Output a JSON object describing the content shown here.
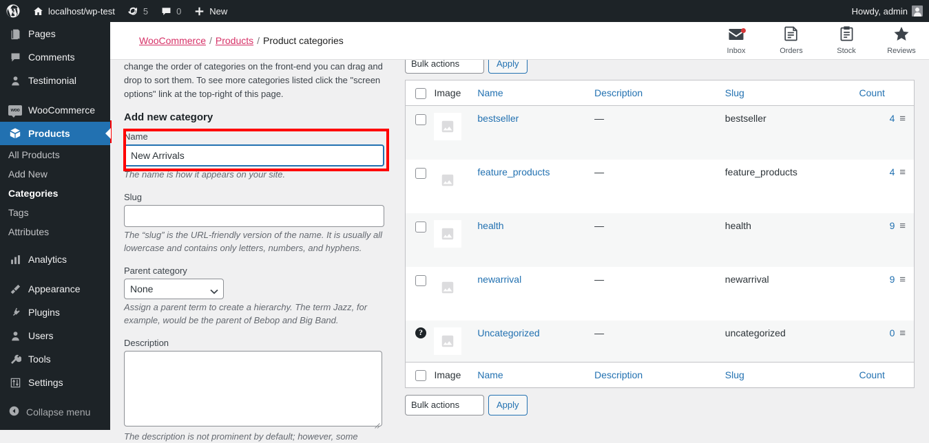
{
  "adminbar": {
    "site_name": "localhost/wp-test",
    "updates_count": "5",
    "comments_count": "0",
    "new_label": "New",
    "howdy": "Howdy, admin"
  },
  "sidebar": {
    "items": [
      {
        "label": "Pages",
        "icon": "pages-icon",
        "type": "top"
      },
      {
        "label": "Comments",
        "icon": "comments-icon",
        "type": "top"
      },
      {
        "label": "Testimonial",
        "icon": "testimonial-icon",
        "type": "top"
      },
      {
        "label": "WooCommerce",
        "icon": "woocommerce-icon",
        "type": "top"
      },
      {
        "label": "Products",
        "icon": "products-icon",
        "type": "top",
        "current": true
      },
      {
        "label": "All Products",
        "type": "sub"
      },
      {
        "label": "Add New",
        "type": "sub"
      },
      {
        "label": "Categories",
        "type": "sub",
        "current": true
      },
      {
        "label": "Tags",
        "type": "sub"
      },
      {
        "label": "Attributes",
        "type": "sub"
      },
      {
        "label": "Analytics",
        "icon": "analytics-icon",
        "type": "top"
      },
      {
        "label": "Appearance",
        "icon": "appearance-icon",
        "type": "top"
      },
      {
        "label": "Plugins",
        "icon": "plugins-icon",
        "type": "top"
      },
      {
        "label": "Users",
        "icon": "users-icon",
        "type": "top"
      },
      {
        "label": "Tools",
        "icon": "tools-icon",
        "type": "top"
      },
      {
        "label": "Settings",
        "icon": "settings-icon",
        "type": "top"
      }
    ],
    "collapse_label": "Collapse menu"
  },
  "header": {
    "breadcrumb": {
      "root": "WooCommerce",
      "parent": "Products",
      "current": "Product categories",
      "separator": "/"
    },
    "actions": [
      {
        "label": "Inbox",
        "icon": "inbox-icon",
        "badge": true
      },
      {
        "label": "Orders",
        "icon": "orders-icon",
        "badge": false
      },
      {
        "label": "Stock",
        "icon": "stock-icon",
        "badge": false
      },
      {
        "label": "Reviews",
        "icon": "reviews-icon",
        "badge": false
      }
    ]
  },
  "form": {
    "intro_text": "change the order of categories on the front-end you can drag and drop to sort them. To see more categories listed click the \"screen options\" link at the top-right of this page.",
    "heading": "Add new category",
    "name": {
      "label": "Name",
      "value": "New Arrivals",
      "help": "The name is how it appears on your site."
    },
    "slug": {
      "label": "Slug",
      "value": "",
      "help": "The “slug” is the URL-friendly version of the name. It is usually all lowercase and contains only letters, numbers, and hyphens."
    },
    "parent": {
      "label": "Parent category",
      "value": "None",
      "options": [
        "None"
      ],
      "help": "Assign a parent term to create a hierarchy. The term Jazz, for example, would be the parent of Bebop and Big Band."
    },
    "description": {
      "label": "Description",
      "value": "",
      "help": "The description is not prominent by default; however, some"
    }
  },
  "bulk": {
    "selected": "Bulk actions",
    "apply_label": "Apply"
  },
  "table": {
    "columns": [
      {
        "label": "Image",
        "sortable": false
      },
      {
        "label": "Name",
        "sortable": true
      },
      {
        "label": "Description",
        "sortable": true
      },
      {
        "label": "Slug",
        "sortable": true
      },
      {
        "label": "Count",
        "sortable": true
      }
    ],
    "rows": [
      {
        "name": "bestseller",
        "description": "—",
        "slug": "bestseller",
        "count": "4",
        "selector": "checkbox"
      },
      {
        "name": "feature_products",
        "description": "—",
        "slug": "feature_products",
        "count": "4",
        "selector": "checkbox"
      },
      {
        "name": "health",
        "description": "—",
        "slug": "health",
        "count": "9",
        "selector": "checkbox"
      },
      {
        "name": "newarrival",
        "description": "—",
        "slug": "newarrival",
        "count": "9",
        "selector": "checkbox"
      },
      {
        "name": "Uncategorized",
        "description": "—",
        "slug": "uncategorized",
        "count": "0",
        "selector": "help"
      }
    ]
  },
  "colors": {
    "admin_dark": "#1d2327",
    "accent_blue": "#2271b1",
    "link_pink": "#d63066",
    "annotation_red": "#ff0000",
    "notification_red": "#d63638"
  }
}
